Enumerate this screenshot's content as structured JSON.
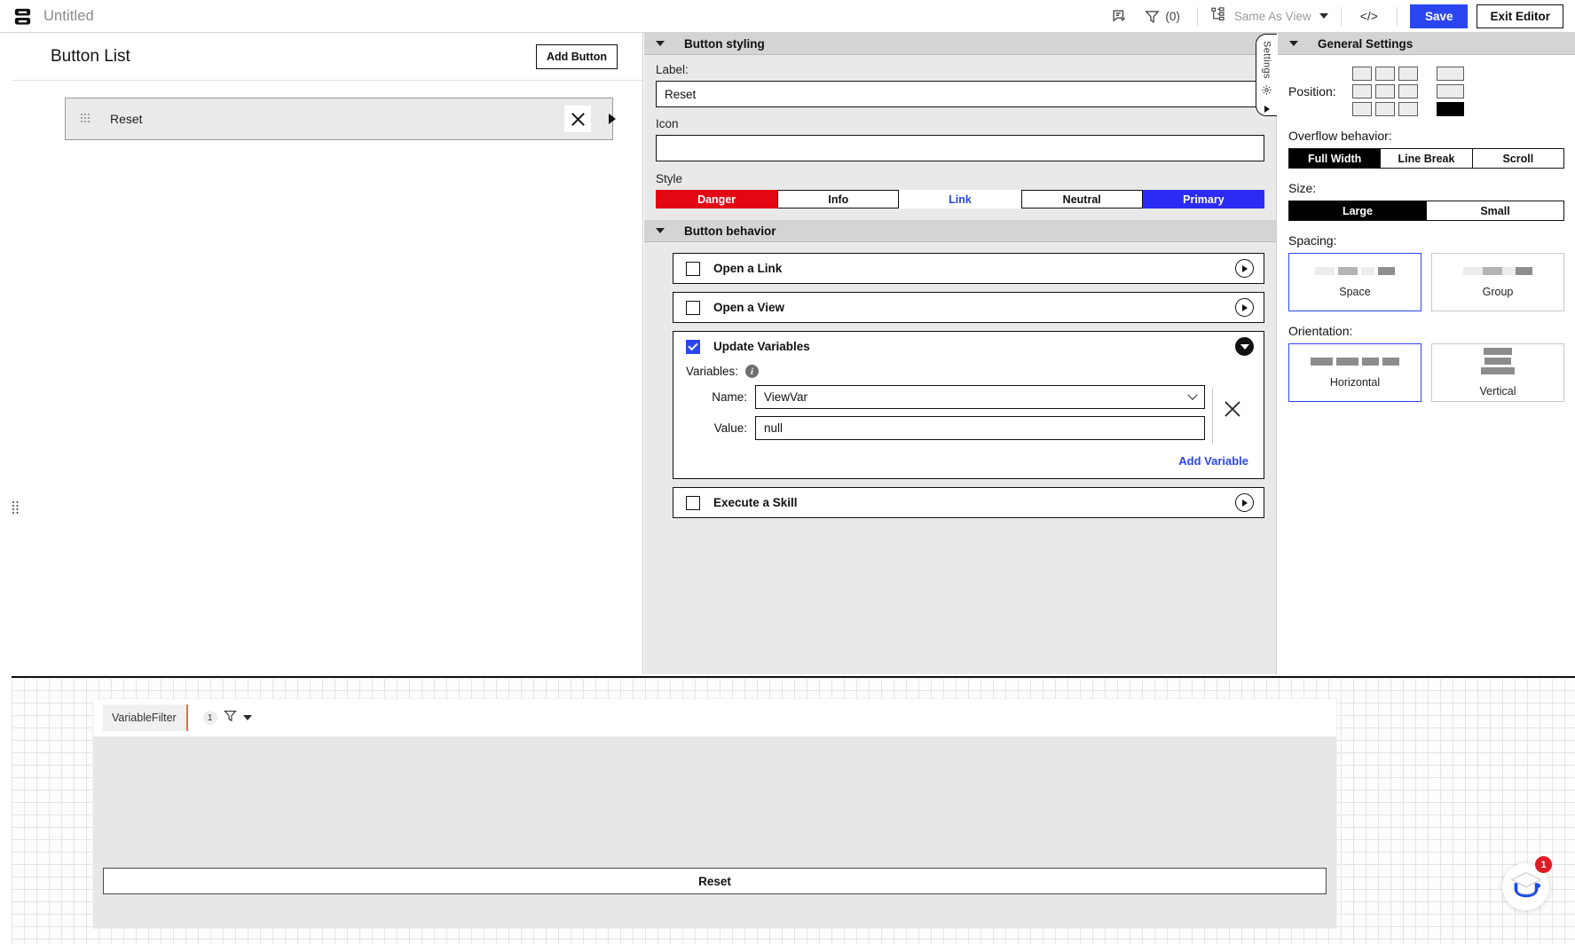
{
  "topbar": {
    "doc_title": "Untitled",
    "comment_icon": "comment-check-icon",
    "filter_icon": "filter-icon",
    "filter_count": "(0)",
    "view_icon": "hierarchy-icon",
    "view_label": "Same As View",
    "code_label": "</>",
    "save_label": "Save",
    "exit_label": "Exit Editor"
  },
  "button_list": {
    "title": "Button List",
    "add_label": "Add Button",
    "rows": [
      {
        "label": "Reset"
      }
    ]
  },
  "settings_tab": {
    "label": "Settings"
  },
  "button_styling": {
    "section_title": "Button styling",
    "label_caption": "Label:",
    "label_value": "Reset",
    "icon_caption": "Icon",
    "icon_value": "",
    "style_caption": "Style",
    "styles": [
      {
        "label": "Danger",
        "variant": "danger",
        "color": "#e30613"
      },
      {
        "label": "Info",
        "variant": "info",
        "color": "#111111"
      },
      {
        "label": "Link",
        "variant": "link",
        "color": "#2b46f0"
      },
      {
        "label": "Neutral",
        "variant": "neutral",
        "color": "#111111"
      },
      {
        "label": "Primary",
        "variant": "primary",
        "color": "#2b2bf5"
      }
    ]
  },
  "button_behavior": {
    "section_title": "Button behavior",
    "items": [
      {
        "label": "Open a Link",
        "checked": false,
        "expanded": false
      },
      {
        "label": "Open a View",
        "checked": false,
        "expanded": false
      },
      {
        "label": "Update Variables",
        "checked": true,
        "expanded": true
      },
      {
        "label": "Execute a Skill",
        "checked": false,
        "expanded": false
      }
    ],
    "variables": {
      "caption": "Variables:",
      "info_icon": "info-icon",
      "name_caption": "Name:",
      "name_value": "ViewVar",
      "value_caption": "Value:",
      "value_value": "null",
      "delete_icon": "close-icon",
      "add_label": "Add Variable",
      "add_color": "#2b46f0"
    }
  },
  "general_settings": {
    "section_title": "General Settings",
    "position_caption": "Position:",
    "position_selected": "bottom",
    "overflow_caption": "Overflow behavior:",
    "overflow_options": [
      "Full Width",
      "Line Break",
      "Scroll"
    ],
    "overflow_selected": "Full Width",
    "size_caption": "Size:",
    "size_options": [
      "Large",
      "Small"
    ],
    "size_selected": "Large",
    "spacing_caption": "Spacing:",
    "spacing_options": [
      "Space",
      "Group"
    ],
    "spacing_selected": "Space",
    "orientation_caption": "Orientation:",
    "orientation_options": [
      "Horizontal",
      "Vertical"
    ],
    "orientation_selected": "Horizontal"
  },
  "canvas": {
    "widget_name": "VariableFilter",
    "filter_badge": "1",
    "filter_icon": "filter-icon",
    "preview_button_label": "Reset",
    "help_icon": "graduation-cap-icon",
    "help_badge": "1"
  }
}
